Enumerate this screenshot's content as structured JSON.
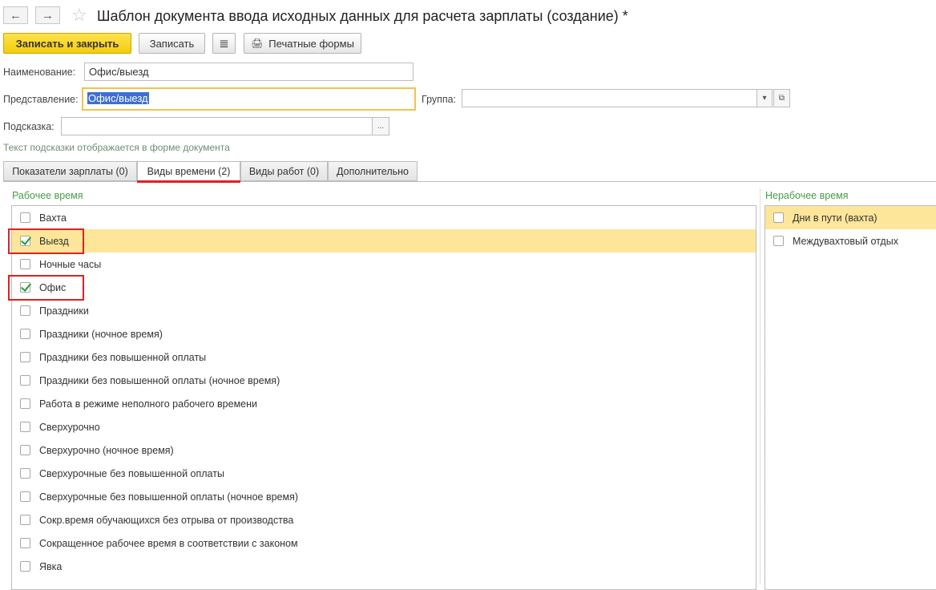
{
  "window": {
    "title": "Шаблон документа ввода исходных данных для расчета зарплаты (создание) *",
    "back_icon": "←",
    "forward_icon": "→",
    "star_icon": "☆"
  },
  "toolbar": {
    "save_close_label": "Записать и закрыть",
    "save_label": "Записать",
    "list_icon": "≣",
    "print_icon": "🖨",
    "print_label": "Печатные формы"
  },
  "form": {
    "name_label": "Наименование:",
    "name_value": "Офис/выезд",
    "repr_label": "Представление:",
    "repr_value": "Офис/выезд",
    "group_label": "Группа:",
    "group_value": "",
    "hint_label": "Подсказка:",
    "hint_value": "",
    "hint_button": "...",
    "hint_text": "Текст подсказки отображается в форме документа",
    "dropdown_icon": "▾",
    "open_icon": "⧉"
  },
  "tabs": [
    {
      "label": "Показатели зарплаты (0)",
      "active": false
    },
    {
      "label": "Виды времени (2)",
      "active": true
    },
    {
      "label": "Виды работ (0)",
      "active": false
    },
    {
      "label": "Дополнительно",
      "active": false
    }
  ],
  "working_time": {
    "header": "Рабочее время",
    "items": [
      {
        "label": "Вахта",
        "checked": false
      },
      {
        "label": "Выезд",
        "checked": true
      },
      {
        "label": "Ночные часы",
        "checked": false
      },
      {
        "label": "Офис",
        "checked": true
      },
      {
        "label": "Праздники",
        "checked": false
      },
      {
        "label": "Праздники (ночное время)",
        "checked": false
      },
      {
        "label": "Праздники без повышенной оплаты",
        "checked": false
      },
      {
        "label": "Праздники без повышенной оплаты (ночное время)",
        "checked": false
      },
      {
        "label": "Работа в режиме неполного рабочего времени",
        "checked": false
      },
      {
        "label": "Сверхурочно",
        "checked": false
      },
      {
        "label": "Сверхурочно (ночное время)",
        "checked": false
      },
      {
        "label": "Сверхурочные без повышенной оплаты",
        "checked": false
      },
      {
        "label": "Сверхурочные без повышенной оплаты (ночное время)",
        "checked": false
      },
      {
        "label": "Сокр.время обучающихся без отрыва от производства",
        "checked": false
      },
      {
        "label": "Сокращенное рабочее время в соответствии с законом",
        "checked": false
      },
      {
        "label": "Явка",
        "checked": false
      }
    ]
  },
  "nonworking_time": {
    "header": "Нерабочее время",
    "items": [
      {
        "label": "Дни в пути (вахта)",
        "checked": false
      },
      {
        "label": "Междувахтовый отдых",
        "checked": false
      }
    ]
  },
  "colors": {
    "primary_button": "#f5cc0b",
    "highlight_row": "#fde699",
    "group_header": "#4a9a4a",
    "annotation_red": "#e02020",
    "check_green": "#1e9c3c"
  }
}
